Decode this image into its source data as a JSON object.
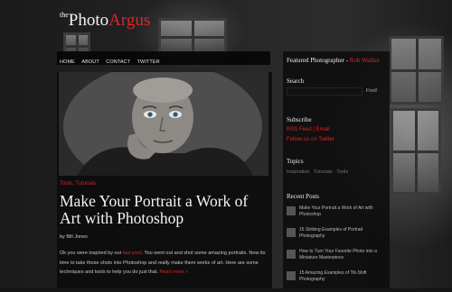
{
  "logo": {
    "the": "the",
    "word1": "Photo",
    "word2": "Argus"
  },
  "nav": [
    "HOME",
    "ABOUT",
    "CONTACT",
    "TWITTER"
  ],
  "post": {
    "category1": "Tools",
    "category2": "Tutorials",
    "title": "Make Your Portrait a Work of Art with Photoshop",
    "byline": "by Bill Jones",
    "excerpt_start": "Ok you were inspired by our ",
    "excerpt_link": "last post",
    "excerpt_rest": ". You went out and shot some amazing portraits. Now its time to take those shots into Photoshop and really make them works of art. Here are some techniques and tools to help you do just that. ",
    "read_more": "Read more »"
  },
  "sidebar": {
    "featured_label": "Featured Photographer - ",
    "featured_name": "Rob Walker",
    "search_heading": "Search",
    "search_button": "Find!",
    "subscribe_heading": "Subscribe",
    "subscribe_links": [
      "RSS Feed | Email",
      "Follow us on Twitter"
    ],
    "topics_heading": "Topics",
    "topics": [
      "Inspiration",
      "Tutorials",
      "Tools"
    ],
    "recent_heading": "Recent Posts",
    "recent_posts": [
      "Make Your Portrait a Work of Art with Photoshop",
      "15 Striking Examples of Portrait Photography",
      "How to Turn Your Favorite Photo into a Miniature Masterpiece",
      "15 Amazing Examples of Tilt-Shift Photography"
    ]
  }
}
